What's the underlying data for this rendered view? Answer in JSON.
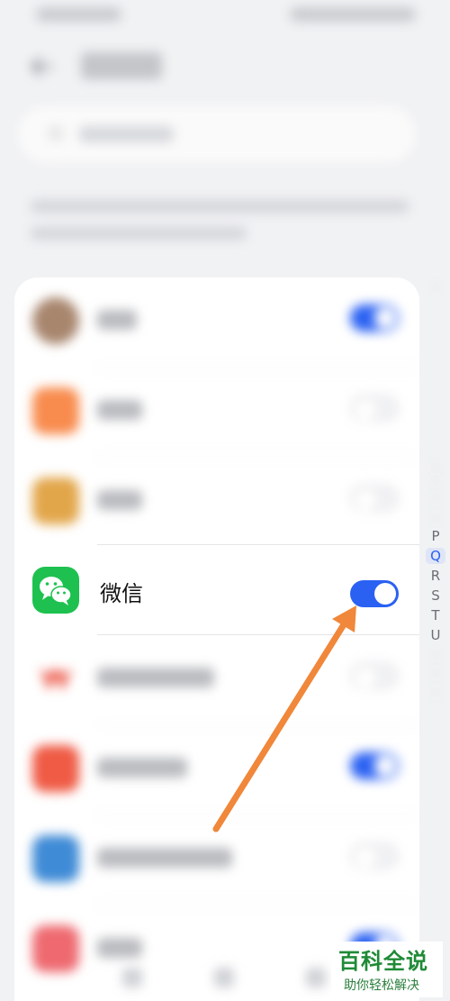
{
  "list": {
    "wechat": {
      "name": "微信",
      "toggle_on": true
    }
  },
  "alphabet": {
    "visible_letters": [
      "P",
      "Q",
      "R",
      "S",
      "T",
      "U"
    ],
    "active": "Q"
  },
  "watermark": {
    "main": "百科全说",
    "sub": "助你轻松解决"
  },
  "colors": {
    "accent": "#2a61f2",
    "wechat_green": "#1ec14f",
    "arrow": "#f0873a"
  },
  "icons": [
    "back-arrow-icon",
    "search-icon",
    "wechat-icon",
    "toggle-switch",
    "annotation-arrow"
  ]
}
